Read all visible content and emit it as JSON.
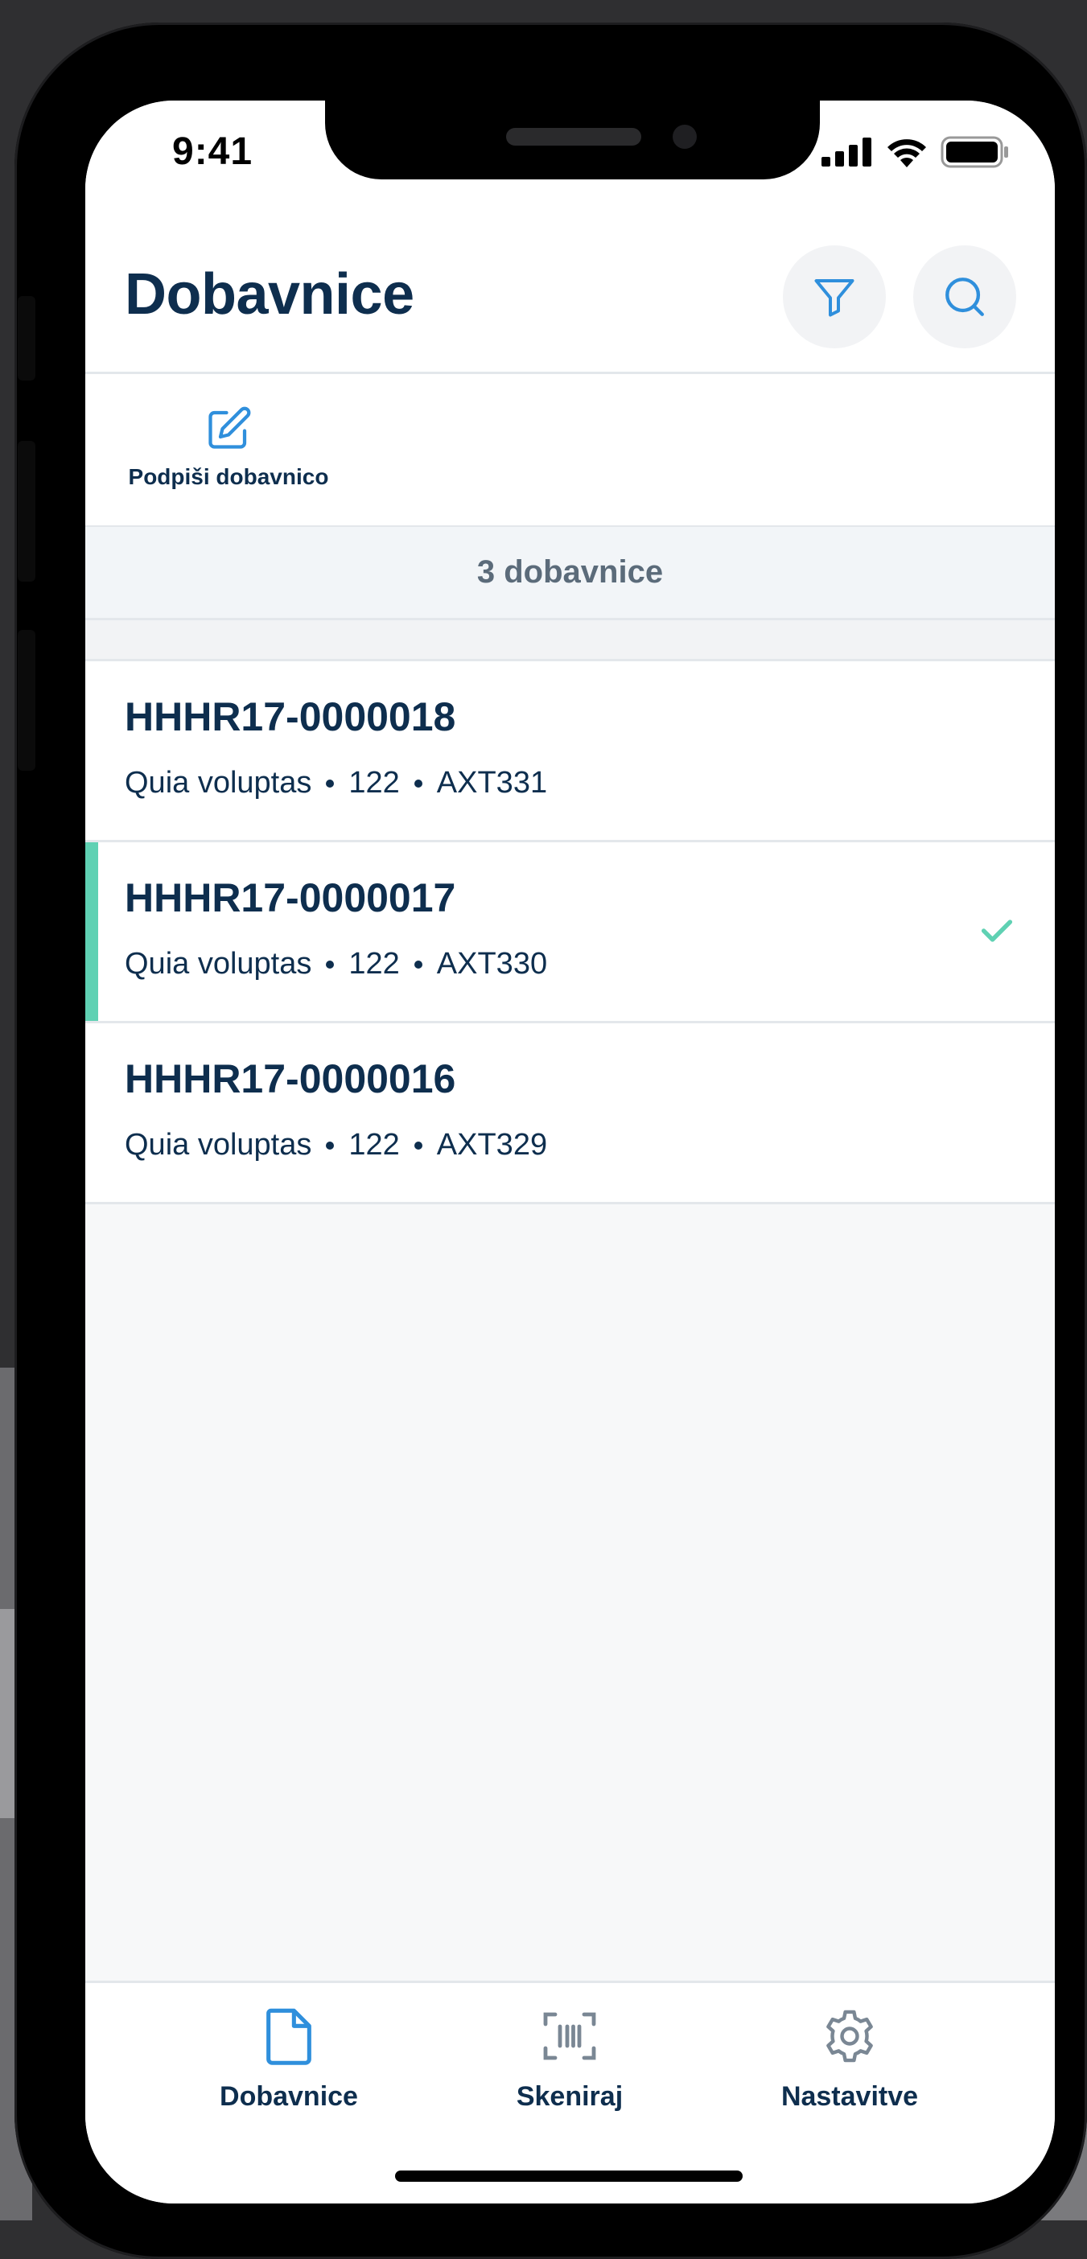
{
  "status_bar": {
    "time": "9:41"
  },
  "header": {
    "title": "Dobavnice"
  },
  "actions": {
    "sign_label": "Podpiši dobavnico"
  },
  "list": {
    "count_label": "3 dobavnice",
    "items": [
      {
        "id": "HHHR17-0000018",
        "name": "Quia voluptas",
        "qty": "122",
        "code": "AXT331",
        "selected": false
      },
      {
        "id": "HHHR17-0000017",
        "name": "Quia voluptas",
        "qty": "122",
        "code": "AXT330",
        "selected": true
      },
      {
        "id": "HHHR17-0000016",
        "name": "Quia voluptas",
        "qty": "122",
        "code": "AXT329",
        "selected": false
      }
    ]
  },
  "tabbar": {
    "items": [
      {
        "label": "Dobavnice",
        "icon": "document-icon",
        "active": true
      },
      {
        "label": "Skeniraj",
        "icon": "barcode-scan-icon",
        "active": false
      },
      {
        "label": "Nastavitve",
        "icon": "gear-icon",
        "active": false
      }
    ]
  },
  "colors": {
    "primary_text": "#0e2e4e",
    "accent_blue": "#2f8fdc",
    "selected_accent": "#5fd1b3",
    "muted_icon": "#7a8794"
  }
}
